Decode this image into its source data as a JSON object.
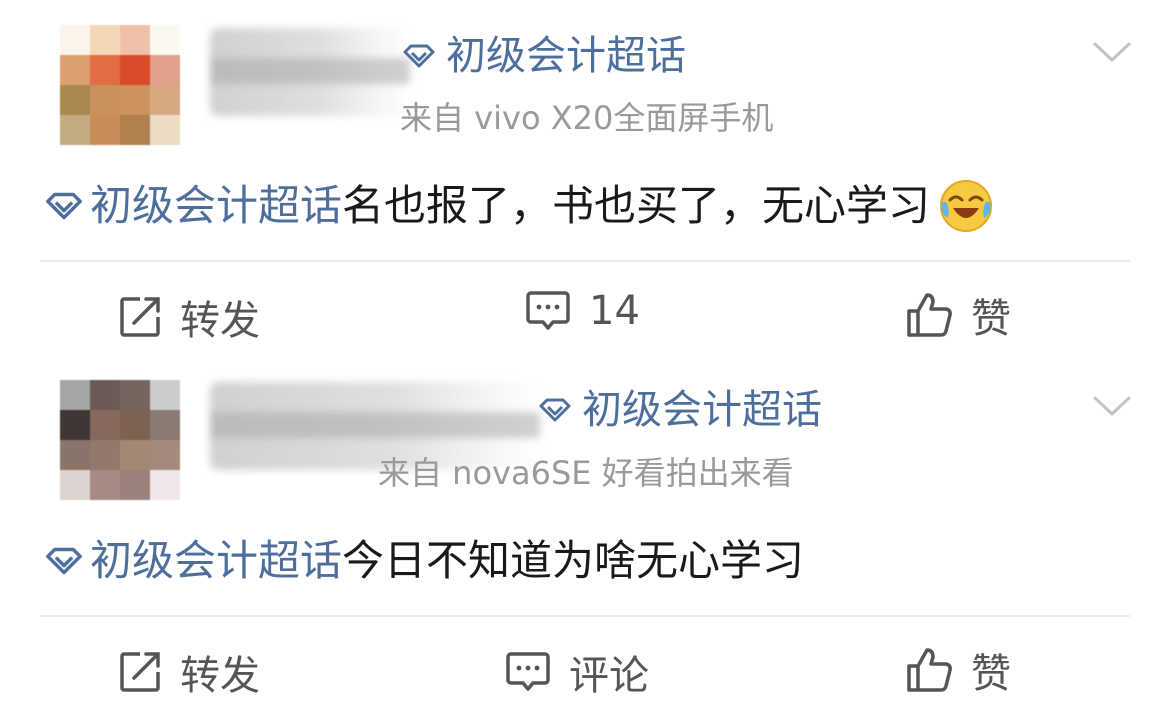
{
  "colors": {
    "link_blue": "#4e6f9c",
    "meta_gray": "#9a9a9a",
    "action_gray": "#555555",
    "divider": "#ececec"
  },
  "posts": [
    {
      "topic": "初级会计超话",
      "source": "来自 vivo X20全面屏手机",
      "body_tag": "初级会计超话",
      "body_text": "名也报了，书也买了，无心学习",
      "body_emoji": "laughing-crying-emoji",
      "actions": {
        "repost": "转发",
        "comment": "14",
        "like": "赞"
      }
    },
    {
      "topic": "初级会计超话",
      "source": "来自 nova6SE 好看拍出来看",
      "body_tag": "初级会计超话",
      "body_text": "今日不知道为啥无心学习",
      "actions": {
        "repost": "转发",
        "comment": "评论",
        "like": "赞"
      }
    }
  ],
  "icons": {
    "topic": "diamond-icon",
    "repost": "share-icon",
    "comment": "comment-icon",
    "like": "thumbs-up-icon",
    "menu": "chevron-down-icon"
  }
}
